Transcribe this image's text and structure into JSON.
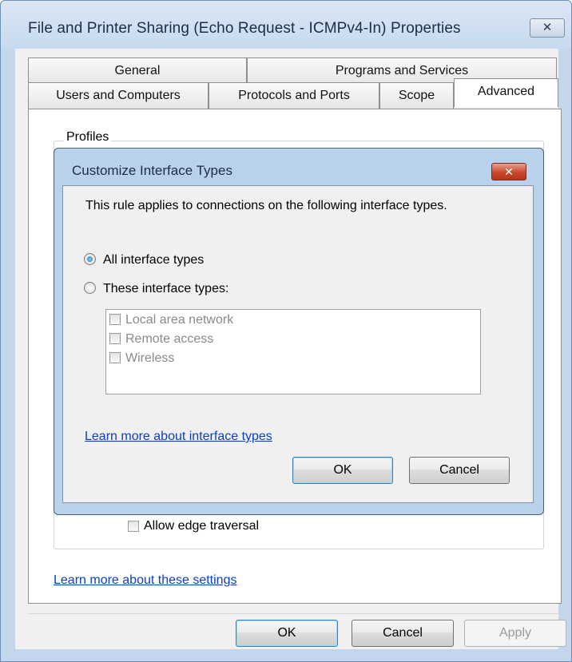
{
  "window": {
    "title": "File and Printer Sharing (Echo Request - ICMPv4-In) Properties",
    "close_glyph": "✕"
  },
  "tabs": {
    "row1": [
      "General",
      "Programs and Services"
    ],
    "row2": [
      "Users and Computers",
      "Protocols and Ports",
      "Scope",
      "Advanced"
    ],
    "active": "Advanced"
  },
  "advanced": {
    "profiles_label": "Profiles",
    "edge_traversal_label": "Allow edge traversal",
    "learn_more_link": "Learn more about these settings"
  },
  "dialog_buttons": {
    "ok": "OK",
    "cancel": "Cancel",
    "apply": "Apply"
  },
  "modal": {
    "title": "Customize Interface Types",
    "close_glyph": "✕",
    "description": "This rule applies to connections on the following interface types.",
    "radio_all": "All interface types",
    "radio_these": "These interface types:",
    "selected": "All interface types",
    "interface_types": [
      "Local area network",
      "Remote access",
      "Wireless"
    ],
    "learn_more_link": "Learn more about interface types",
    "ok": "OK",
    "cancel": "Cancel"
  }
}
